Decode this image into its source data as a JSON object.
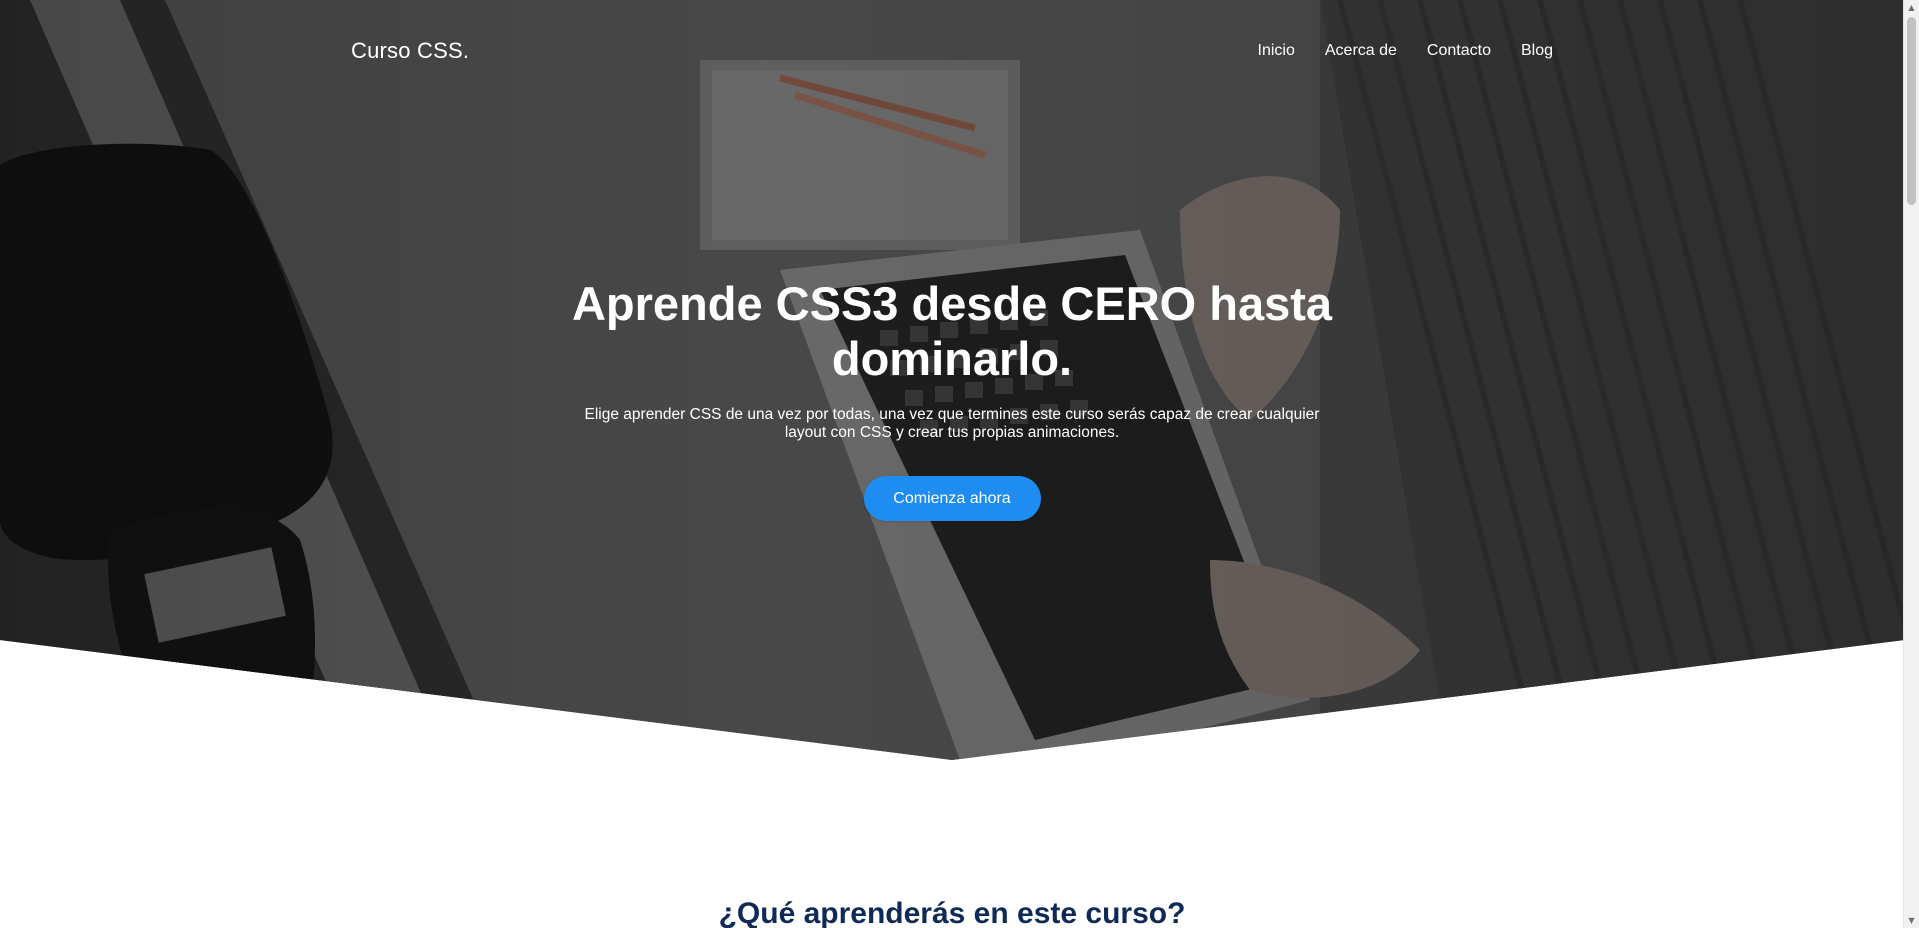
{
  "header": {
    "logo": "Curso CSS.",
    "nav": [
      {
        "label": "Inicio"
      },
      {
        "label": "Acerca de"
      },
      {
        "label": "Contacto"
      },
      {
        "label": "Blog"
      }
    ]
  },
  "hero": {
    "title": "Aprende CSS3 desde CERO hasta dominarlo.",
    "subtitle": "Elige aprender CSS de una vez por todas, una vez que termines este curso serás capaz de crear cualquier layout con CSS y crear tus propias animaciones.",
    "cta_label": "Comienza ahora"
  },
  "section": {
    "heading": "¿Qué aprenderás en este curso?"
  },
  "colors": {
    "accent": "#1e8cf1",
    "heading": "#0f2a56",
    "text_on_hero": "#ffffff"
  },
  "scrollbar": {
    "up_icon": "▲",
    "down_icon": "▼"
  }
}
